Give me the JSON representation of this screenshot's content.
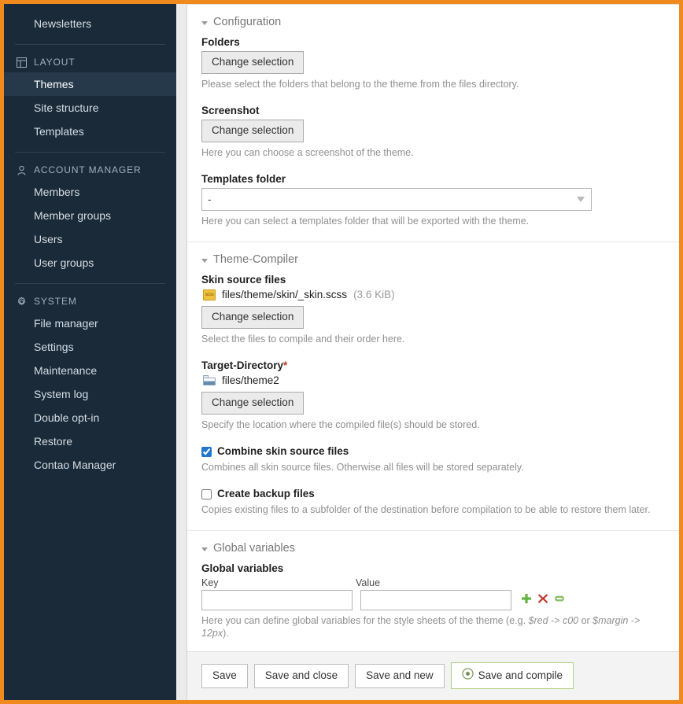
{
  "theme": {
    "accent_orange": "#f18a1e",
    "sidebar_bg": "#1b2a38",
    "sidebar_active_bg": "#25394b",
    "required_marker": "#c0392b",
    "checkbox_accent": "#2277cc",
    "compile_button_border": "#b4ce7f"
  },
  "sidebar": {
    "top_item": {
      "label": "Newsletters"
    },
    "groups": [
      {
        "icon": "layout-icon",
        "title": "LAYOUT",
        "items": [
          {
            "label": "Themes",
            "active": true
          },
          {
            "label": "Site structure",
            "active": false
          },
          {
            "label": "Templates",
            "active": false
          }
        ]
      },
      {
        "icon": "user-icon",
        "title": "ACCOUNT MANAGER",
        "items": [
          {
            "label": "Members",
            "active": false
          },
          {
            "label": "Member groups",
            "active": false
          },
          {
            "label": "Users",
            "active": false
          },
          {
            "label": "User groups",
            "active": false
          }
        ]
      },
      {
        "icon": "gear-icon",
        "title": "SYSTEM",
        "items": [
          {
            "label": "File manager",
            "active": false
          },
          {
            "label": "Settings",
            "active": false
          },
          {
            "label": "Maintenance",
            "active": false
          },
          {
            "label": "System log",
            "active": false
          },
          {
            "label": "Double opt-in",
            "active": false
          },
          {
            "label": "Restore",
            "active": false
          },
          {
            "label": "Contao Manager",
            "active": false
          }
        ]
      }
    ]
  },
  "configuration": {
    "legend": "Configuration",
    "folders": {
      "label": "Folders",
      "button": "Change selection",
      "hint": "Please select the folders that belong to the theme from the files directory."
    },
    "screenshot": {
      "label": "Screenshot",
      "button": "Change selection",
      "hint": "Here you can choose a screenshot of the theme."
    },
    "templates_folder": {
      "label": "Templates folder",
      "value": "-",
      "options": [
        "-"
      ],
      "hint": "Here you can select a templates folder that will be exported with the theme."
    }
  },
  "theme_compiler": {
    "legend": "Theme-Compiler",
    "skin_source_files": {
      "label": "Skin source files",
      "file_name": "files/theme/skin/_skin.scss",
      "file_size": "(3.6 KiB)",
      "file_icon": "scss-file-icon",
      "button": "Change selection",
      "hint": "Select the files to compile and their order here."
    },
    "target_directory": {
      "label": "Target-Directory",
      "required_mark": "*",
      "path": "files/theme2",
      "path_icon": "folder-icon",
      "button": "Change selection",
      "hint": "Specify the location where the compiled file(s) should be stored."
    },
    "combine_skin_source_files": {
      "label": "Combine skin source files",
      "checked": true,
      "hint": "Combines all skin source files. Otherwise all files will be stored separately."
    },
    "create_backup_files": {
      "label": "Create backup files",
      "checked": false,
      "hint": "Copies existing files to a subfolder of the destination before compilation to be able to restore them later."
    }
  },
  "global_variables": {
    "legend": "Global variables",
    "label": "Global variables",
    "key_header": "Key",
    "value_header": "Value",
    "key_value": "",
    "value_value": "",
    "row_actions": [
      {
        "name": "add-row-icon",
        "glyph": "+"
      },
      {
        "name": "delete-row-icon",
        "glyph": "✖"
      },
      {
        "name": "drag-handle-icon",
        "glyph": "−"
      }
    ],
    "hint_prefix": "Here you can define global variables for the style sheets of the theme (e.g. ",
    "hint_var1": "$red -> c00",
    "hint_mid": " or ",
    "hint_var2": "$margin ->  12px",
    "hint_suffix": ")."
  },
  "footer": {
    "save": "Save",
    "save_and_close": "Save and close",
    "save_and_new": "Save and new",
    "save_and_compile": "Save and compile",
    "compile_icon": "compile-disc-icon"
  }
}
